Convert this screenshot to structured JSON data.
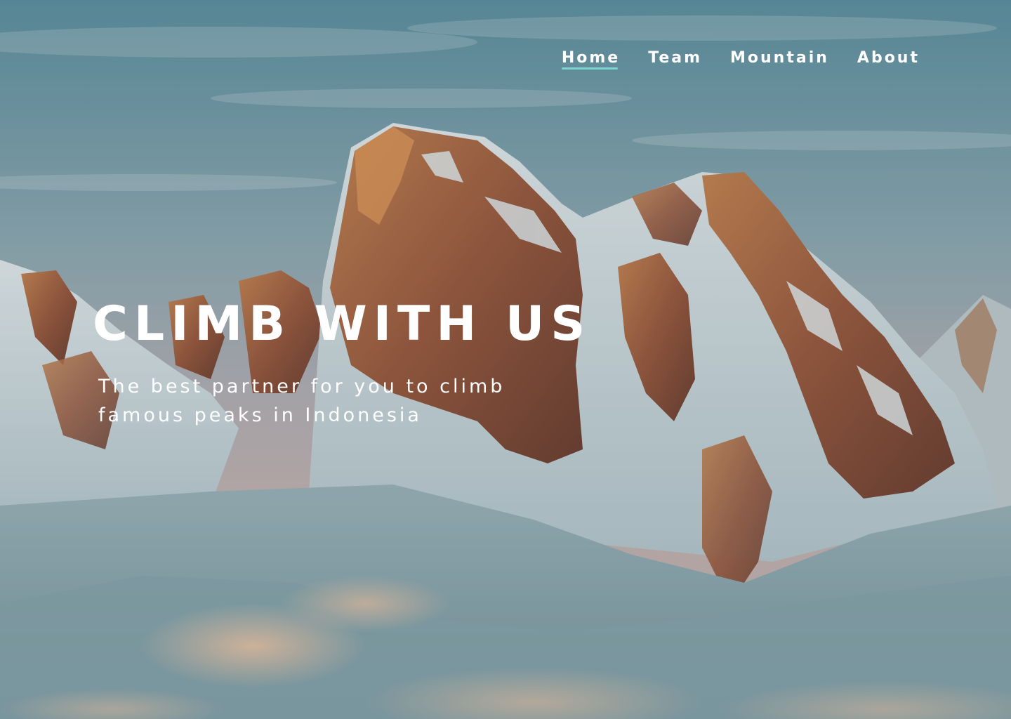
{
  "nav": {
    "items": [
      {
        "label": "Home",
        "active": true
      },
      {
        "label": "Team",
        "active": false
      },
      {
        "label": "Mountain",
        "active": false
      },
      {
        "label": "About",
        "active": false
      }
    ]
  },
  "hero": {
    "title": "CLIMB WITH US",
    "subtitle": "The best partner for you to climb famous peaks in Indonesia",
    "background": "snowy-mountain-photo"
  },
  "colors": {
    "text": "#ffffff",
    "nav_underline": "#7fd3d0",
    "sky": "#7ea6b3",
    "rock": "#9c5a3e",
    "snow": "#d6e3e6"
  }
}
